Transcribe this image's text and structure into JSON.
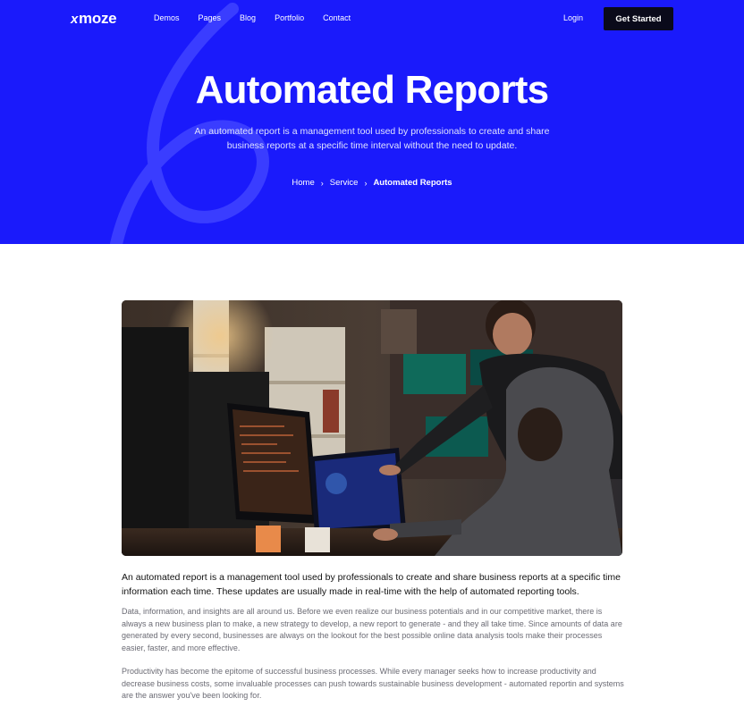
{
  "brand": {
    "name": "moze",
    "mark": "x"
  },
  "nav": {
    "items": [
      "Demos",
      "Pages",
      "Blog",
      "Portfolio",
      "Contact"
    ],
    "login_label": "Login",
    "cta_label": "Get Started"
  },
  "hero": {
    "title": "Automated Reports",
    "subtitle": "An automated report is a management tool used by professionals to create and share business reports at a specific time interval without the need to update.",
    "background_color": "#1a1afb"
  },
  "breadcrumb": {
    "items": [
      "Home",
      "Service",
      "Automated Reports"
    ],
    "separator": "›"
  },
  "content": {
    "image_icon": "office-computers-photo",
    "lead": "An automated report is a management tool used by professionals to create and share business reports at a specific time  information each time. These updates are usually made in real-time with the help of automated reporting tools.",
    "paragraphs": [
      "Data, information, and insights are all around us. Before we even realize our business potentials and  in our competitive market, there is always a new business plan to make, a new strategy to develop, a new report to generate - and they all take time. Since amounts of data are generated by every second, businesses are always on the lookout for the best possible online data analysis tools  make their processes easier, faster, and more effective.",
      "Productivity has become the epitome of successful business processes. While every manager seeks how to increase productivity and decrease business costs, some invaluable processes can push towards sustainable business development - automated reportin and systems are the answer you've been looking for."
    ]
  }
}
